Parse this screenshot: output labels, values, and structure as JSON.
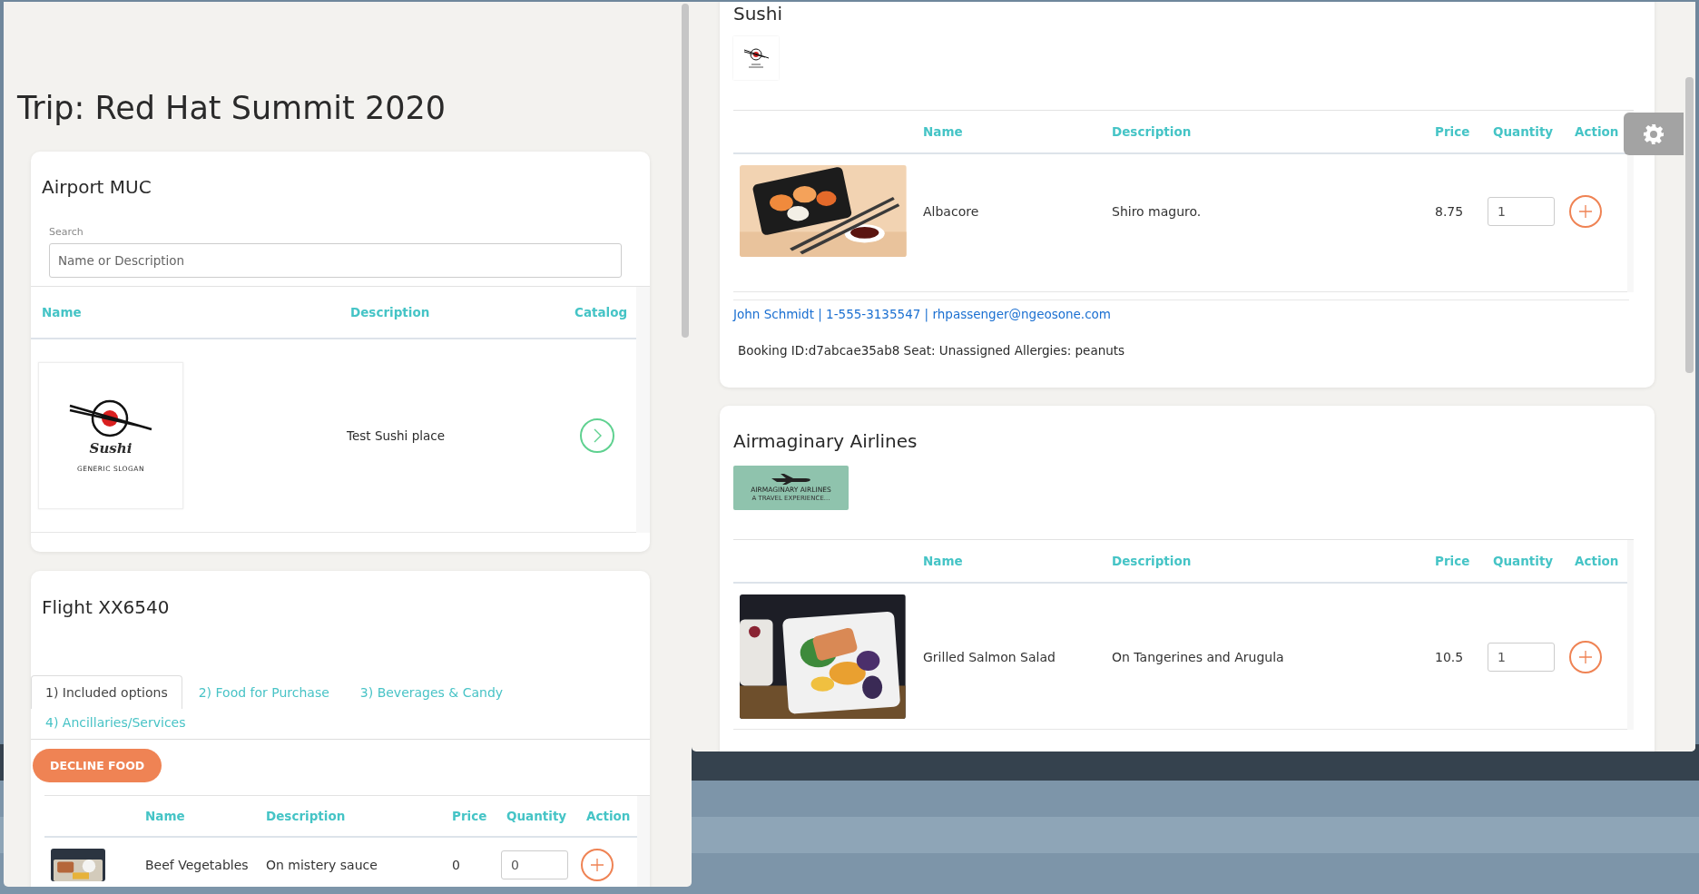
{
  "trip_window": {
    "title": "Trip: Red Hat Summit 2020",
    "airport_card": {
      "title": "Airport MUC",
      "search": {
        "label": "Search",
        "placeholder": "Name or Description"
      },
      "columns": [
        "Name",
        "Description",
        "Catalog"
      ],
      "rows": [
        {
          "logo_name": "Sushi",
          "logo_slogan": "GENERIC SLOGAN",
          "description": "Test Sushi place"
        }
      ]
    },
    "flight_card": {
      "title": "Flight XX6540",
      "tabs": [
        {
          "label": "1) Included options",
          "selected": true
        },
        {
          "label": "2) Food for Purchase",
          "selected": false
        },
        {
          "label": "3) Beverages & Candy",
          "selected": false
        },
        {
          "label": "4) Ancillaries/Services",
          "selected": false
        }
      ],
      "decline_button": "DECLINE FOOD",
      "columns": [
        "Name",
        "Description",
        "Price",
        "Quantity",
        "Action"
      ],
      "rows": [
        {
          "kind": "item",
          "name": "Beef Vegetables",
          "description": "On mistery sauce",
          "price": "0",
          "quantity": "0"
        }
      ]
    }
  },
  "catalog_window": {
    "vendors": [
      {
        "title": "Sushi",
        "logo": {
          "kind": "sushi"
        },
        "columns": [
          "Name",
          "Description",
          "Price",
          "Quantity",
          "Action"
        ],
        "rows": [
          {
            "kind": "item",
            "name": "Albacore",
            "description": "Shiro maguro.",
            "price": "8.75",
            "quantity": "1"
          }
        ],
        "contact": "John Schmidt | 1-555-3135547 | rhpassenger@ngeosone.com",
        "booking": "Booking ID:d7abcae35ab8 Seat: Unassigned Allergies: peanuts"
      },
      {
        "title": "Airmaginary Airlines",
        "logo": {
          "kind": "airline",
          "name": "AIRMAGINARY AIRLINES",
          "tagline": "A TRAVEL EXPERIENCE..."
        },
        "columns": [
          "Name",
          "Description",
          "Price",
          "Quantity",
          "Action"
        ],
        "rows": [
          {
            "kind": "item",
            "name": "Grilled Salmon Salad",
            "description": "On Tangerines and Arugula",
            "price": "10.5",
            "quantity": "1"
          }
        ]
      }
    ]
  }
}
